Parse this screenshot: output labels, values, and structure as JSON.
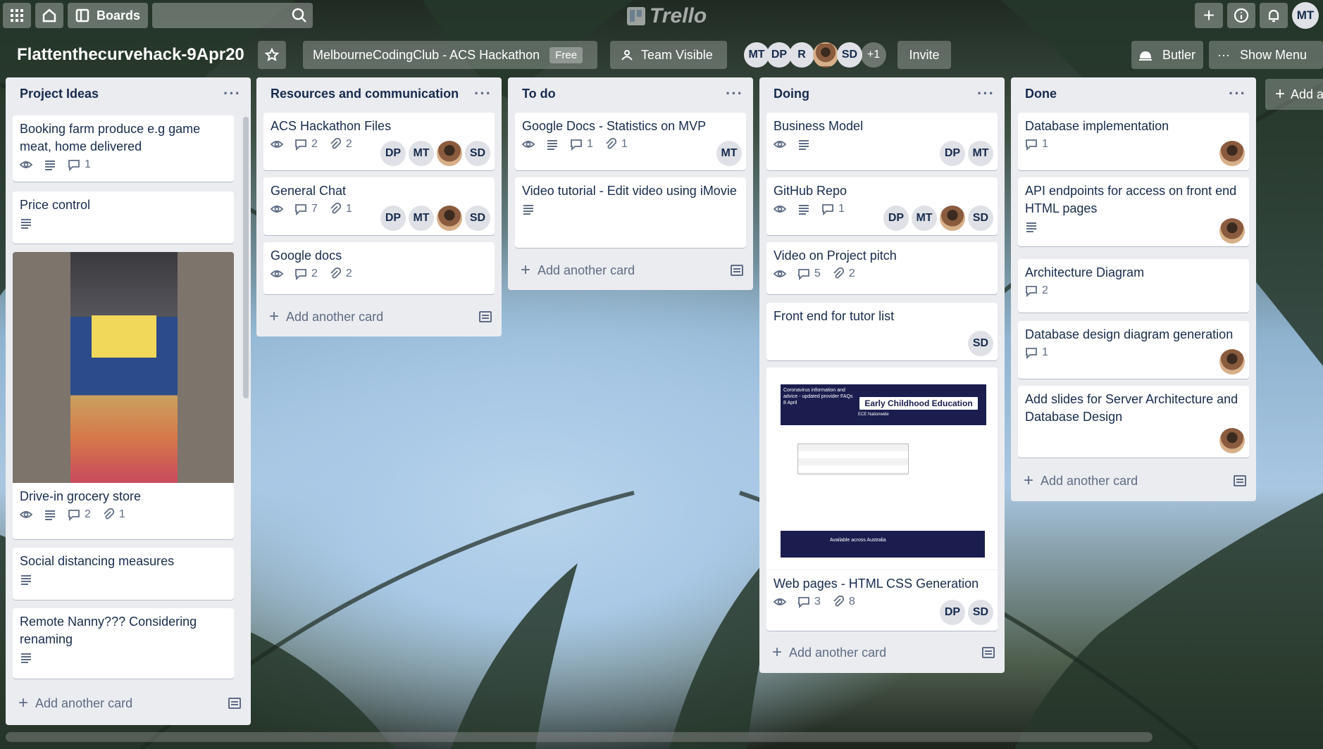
{
  "topbar": {
    "boards_label": "Boards",
    "logo_text": "Trello",
    "user_initials": "MT"
  },
  "board": {
    "title": "Flattenthecurvehack-9Apr20",
    "team": "MelbourneCodingClub - ACS Hackathon",
    "plan_badge": "Free",
    "visibility": "Team Visible",
    "members": [
      "MT",
      "DP",
      "R",
      "",
      "SD"
    ],
    "members_more": "+1",
    "invite_label": "Invite",
    "butler_label": "Butler",
    "show_menu_label": "Show Menu",
    "add_list_label": "Add a"
  },
  "lists": [
    {
      "title": "Project Ideas",
      "cards": [
        {
          "title": "Booking farm produce e.g game meat, home delivered",
          "comments": "1"
        },
        {
          "title": "Price control"
        },
        {
          "title": "Drive-in grocery store",
          "comments": "2",
          "attachments": "1"
        },
        {
          "title": "Social distancing measures"
        },
        {
          "title": "Remote Nanny??? Considering renaming"
        }
      ],
      "add_card": "Add another card"
    },
    {
      "title": "Resources and communication",
      "cards": [
        {
          "title": "ACS Hackathon Files",
          "comments": "2",
          "attachments": "2",
          "members": [
            "DP",
            "MT",
            "",
            "SD"
          ]
        },
        {
          "title": "General Chat",
          "comments": "7",
          "attachments": "1",
          "members": [
            "DP",
            "MT",
            "",
            "SD"
          ]
        },
        {
          "title": "Google docs",
          "comments": "2",
          "attachments": "2"
        }
      ],
      "add_card": "Add another card"
    },
    {
      "title": "To do",
      "cards": [
        {
          "title": "Google Docs - Statistics on MVP",
          "comments": "1",
          "attachments": "1",
          "members": [
            "MT"
          ]
        },
        {
          "title": "Video tutorial - Edit video using iMovie"
        }
      ],
      "add_card": "Add another card"
    },
    {
      "title": "Doing",
      "cards": [
        {
          "title": "Business Model",
          "members": [
            "DP",
            "MT"
          ]
        },
        {
          "title": "GitHub Repo",
          "comments": "1",
          "members": [
            "DP",
            "MT",
            "",
            "SD"
          ]
        },
        {
          "title": "Video on Project pitch",
          "comments": "5",
          "attachments": "2"
        },
        {
          "title": "Front end for tutor list",
          "members": [
            "SD"
          ]
        },
        {
          "title": "Web pages - HTML CSS Generation",
          "comments": "3",
          "attachments": "8",
          "members": [
            "DP",
            "SD"
          ]
        }
      ],
      "web_preview": {
        "banner_text": "Coronavirus information and advice - updated provider FAQs 8 April",
        "headline": "Early Childhood Education",
        "subhead": "ECE Nationwide",
        "footer_text": "Available across Australia"
      },
      "add_card": "Add another card"
    },
    {
      "title": "Done",
      "cards": [
        {
          "title": "Database implementation",
          "comments": "1"
        },
        {
          "title": "API endpoints for access on front end HTML pages"
        },
        {
          "title": "Architecture Diagram",
          "comments": "2"
        },
        {
          "title": "Database design diagram generation",
          "comments": "1"
        },
        {
          "title": "Add slides for Server Architecture and Database Design"
        }
      ],
      "add_card": "Add another card"
    }
  ],
  "colors": {
    "list_bg": "#ebecf0",
    "card_bg": "#ffffff",
    "sky": "#a9c9e6"
  }
}
